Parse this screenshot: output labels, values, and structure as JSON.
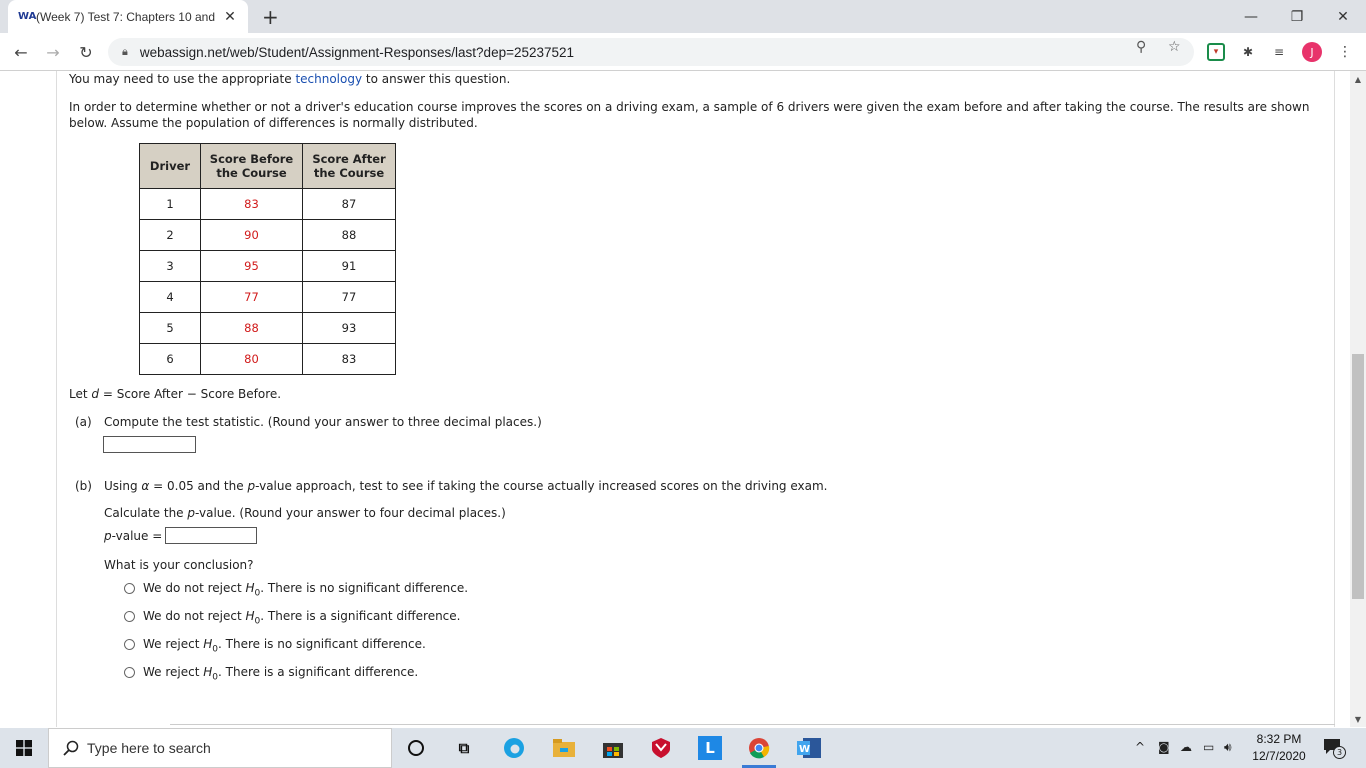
{
  "browser": {
    "tab_title": "(Week 7) Test 7: Chapters 10 and",
    "tab_favicon": "WA",
    "new_tab_label": "+",
    "url": "webassign.net/web/Student/Assignment-Responses/last?dep=25237521",
    "avatar_letter": "J",
    "minimize_glyph": "—",
    "restore_glyph": "❐",
    "close_glyph": "✕"
  },
  "question": {
    "intro_prefix": "You may need to use the appropriate",
    "intro_link": "technology",
    "intro_suffix": "to answer this question.",
    "para_line1": "In order to determine whether or not a driver's education course improves the scores on a driving exam, a sample of 6 drivers were given the exam before and after taking the course. The results are shown",
    "para_line2": "below. Assume the population of differences is normally distributed.",
    "table": {
      "headers": [
        "Driver",
        "Score Before the Course",
        "Score After the Course"
      ],
      "rows": [
        [
          "1",
          "83",
          "87"
        ],
        [
          "2",
          "90",
          "88"
        ],
        [
          "3",
          "95",
          "91"
        ],
        [
          "4",
          "77",
          "77"
        ],
        [
          "5",
          "88",
          "93"
        ],
        [
          "6",
          "80",
          "83"
        ]
      ]
    },
    "let_prefix": "Let ",
    "let_var": "d",
    "let_suffix": " = Score After − Score Before.",
    "part_a_label": "(a)",
    "part_a_text": "Compute the test statistic. (Round your answer to three decimal places.)",
    "part_b_label": "(b)",
    "part_b_text_1": "Using ",
    "part_b_alpha": "α",
    "part_b_text_2": " = 0.05 and the ",
    "part_b_p": "p",
    "part_b_text_3": "-value approach, test to see if taking the course actually increased scores on the driving exam.",
    "calc_text_1": "Calculate the ",
    "calc_p": "p",
    "calc_text_2": "-value. (Round your answer to four decimal places.)",
    "pvalue_p": "p",
    "pvalue_label": "-value =",
    "conclusion_prompt": "What is your conclusion?",
    "options": [
      {
        "pre": "We do not reject ",
        "post": ". There is no significant difference."
      },
      {
        "pre": "We do not reject ",
        "post": ". There is a significant difference."
      },
      {
        "pre": "We reject ",
        "post": ". There is no significant difference."
      },
      {
        "pre": "We reject ",
        "post": ". There is a significant difference."
      }
    ],
    "h_symbol": "H",
    "h_sub": "0"
  },
  "taskbar": {
    "search_placeholder": "Type here to search",
    "time": "8:32 PM",
    "date": "12/7/2020",
    "notification_count": "3"
  }
}
